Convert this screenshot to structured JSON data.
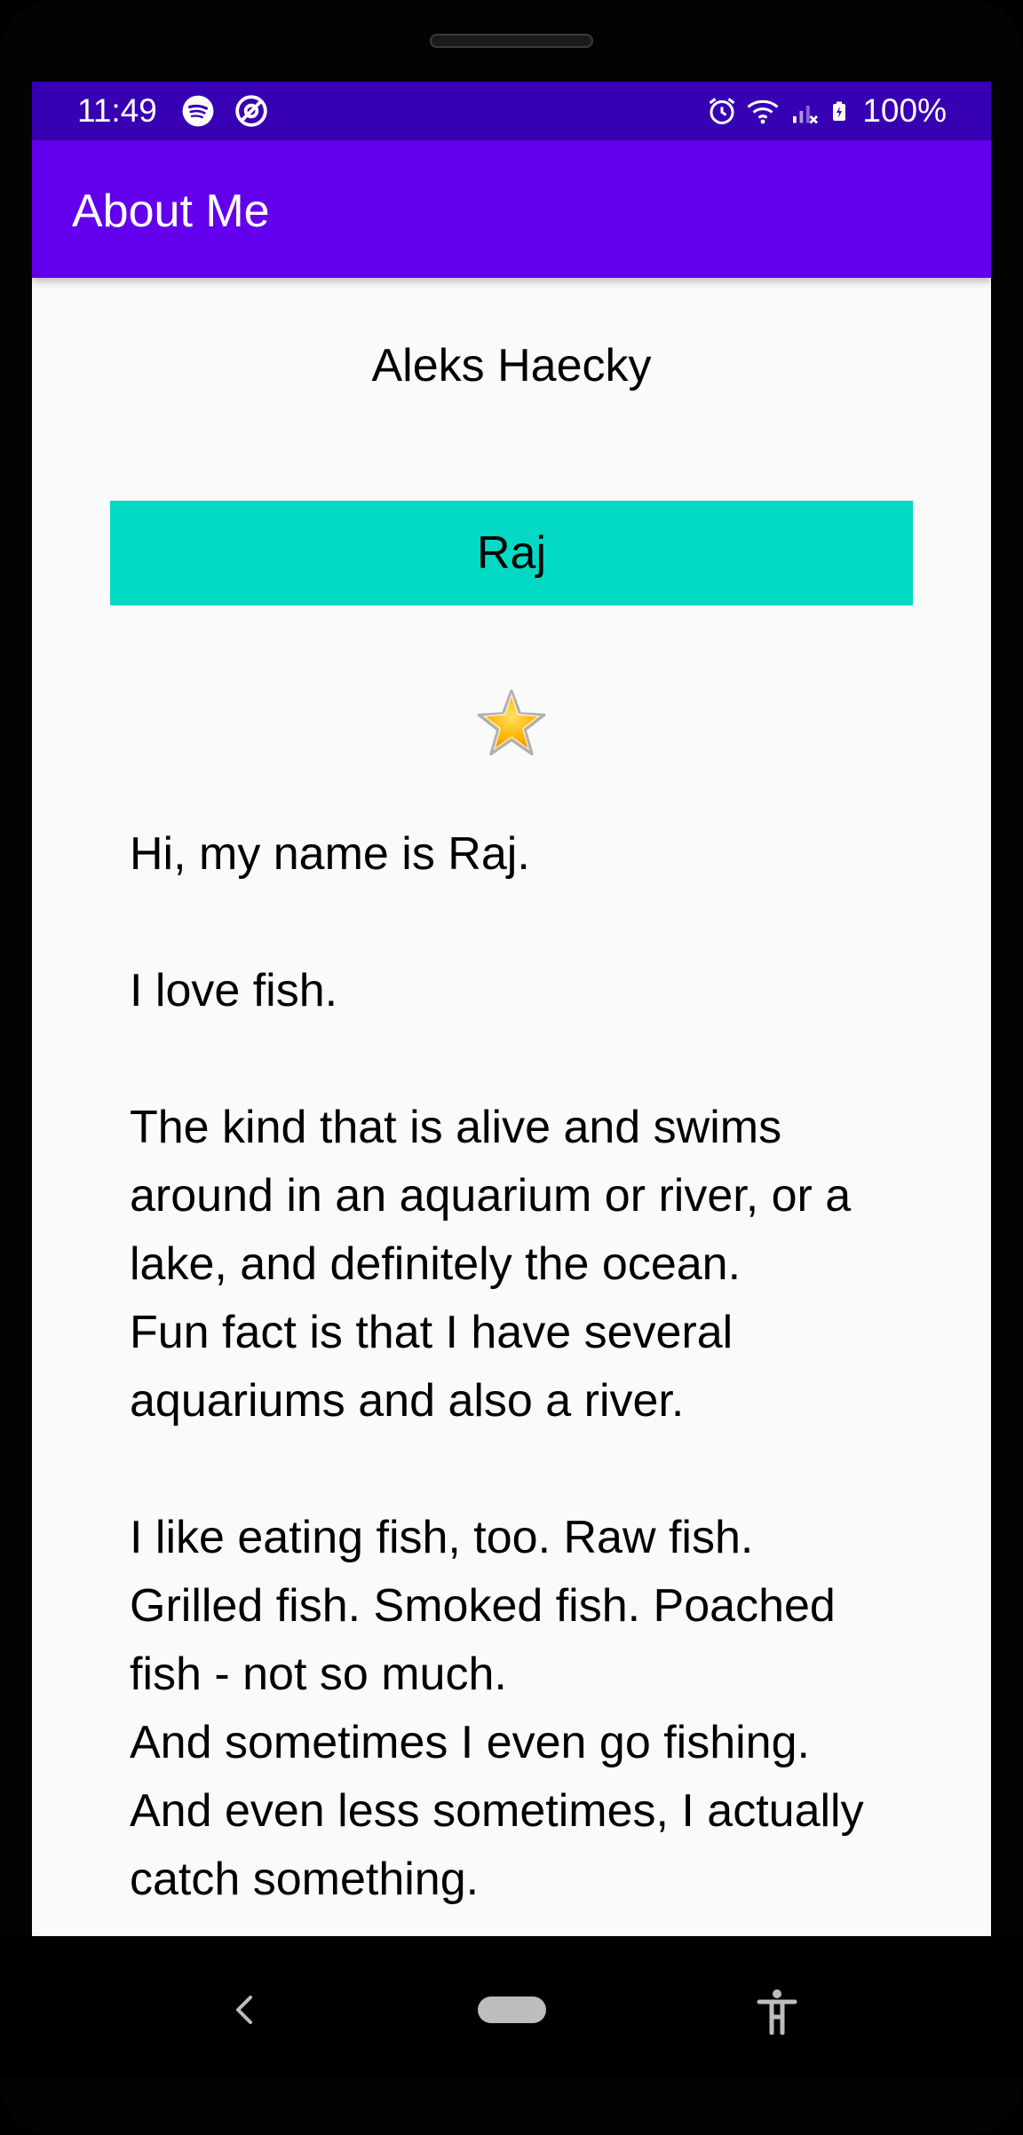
{
  "status_bar": {
    "time": "11:49",
    "left_icons": [
      "spotify-icon",
      "at-sign-notification-icon"
    ],
    "right_icons": [
      "alarm-icon",
      "wifi-icon",
      "cell-signal-icon",
      "battery-charging-icon"
    ],
    "battery": "100%"
  },
  "app_bar": {
    "title": "About Me",
    "color": "#6200ee",
    "status_color": "#3700b3"
  },
  "profile": {
    "name": "Aleks Haecky",
    "nickname": "Raj",
    "nickname_bg": "#03dac5",
    "star_icon": "star-icon"
  },
  "bio": {
    "text": "Hi, my name is Raj.\n\nI love fish.\n\nThe kind that is alive and swims around in an aquarium or river, or a lake, and definitely the ocean.\nFun fact is that I have several aquariums and also a river.\n\nI like eating fish, too. Raw fish. Grilled fish. Smoked fish. Poached fish - not so much.\nAnd sometimes I even go fishing.\nAnd even less sometimes, I actually catch something."
  },
  "nav_bar": {
    "icons": [
      "back-icon",
      "home-pill",
      "accessibility-icon"
    ]
  }
}
